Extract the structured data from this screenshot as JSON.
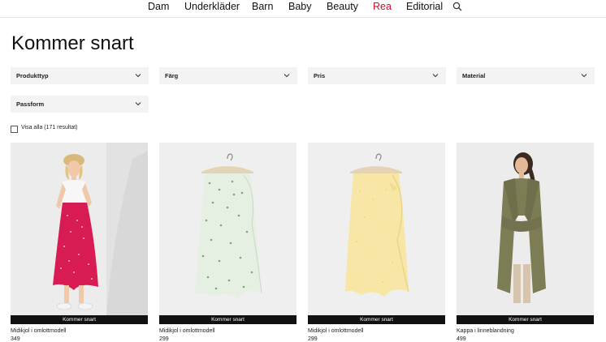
{
  "nav": {
    "items": [
      {
        "label": "Dam"
      },
      {
        "label": "Underkläder"
      },
      {
        "label": "Barn"
      },
      {
        "label": "Baby"
      },
      {
        "label": "Beauty"
      },
      {
        "label": "Rea",
        "color": "#c8102e"
      },
      {
        "label": "Editorial"
      }
    ],
    "search_icon": "search-icon"
  },
  "page": {
    "title": "Kommer snart"
  },
  "filters": [
    {
      "label": "Produkttyp",
      "icon": "chevron-down-icon"
    },
    {
      "label": "Färg",
      "icon": "chevron-down-icon"
    },
    {
      "label": "Pris",
      "icon": "chevron-down-icon"
    },
    {
      "label": "Material",
      "icon": "chevron-down-icon"
    },
    {
      "label": "Passform",
      "icon": "chevron-down-icon"
    }
  ],
  "show_all": {
    "label": "Visa alla (171 resultat)",
    "checked": false
  },
  "products": [
    {
      "badge": "Kommer snart",
      "name": "Midikjol i omlottmodell",
      "price": "349"
    },
    {
      "badge": "Kommer snart",
      "name": "Midikjol i omlottmodell",
      "price": "299"
    },
    {
      "badge": "Kommer snart",
      "name": "Midikjol i omlottmodell",
      "price": "299"
    },
    {
      "badge": "Kommer snart",
      "name": "Kappa i linneblandning",
      "price": "499"
    }
  ],
  "colors": {
    "accent_sale": "#c8102e",
    "badge_bg": "#111111",
    "filter_bg": "#f3f3f3"
  }
}
